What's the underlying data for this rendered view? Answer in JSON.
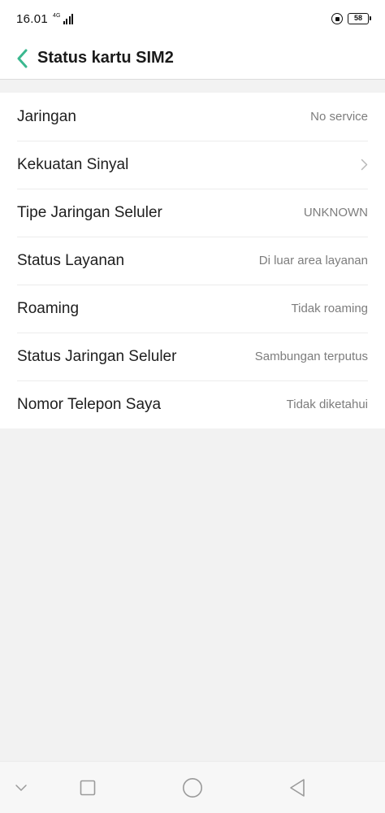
{
  "status_bar": {
    "time": "16.01",
    "network_type": "4G",
    "battery_level": "58"
  },
  "header": {
    "title": "Status kartu SIM2"
  },
  "rows": [
    {
      "label": "Jaringan",
      "value": "No service"
    },
    {
      "label": "Kekuatan Sinyal",
      "value": ""
    },
    {
      "label": "Tipe Jaringan Seluler",
      "value": "UNKNOWN"
    },
    {
      "label": "Status Layanan",
      "value": "Di luar area layanan"
    },
    {
      "label": "Roaming",
      "value": "Tidak roaming"
    },
    {
      "label": "Status Jaringan Seluler",
      "value": "Sambungan terputus"
    },
    {
      "label": "Nomor Telepon Saya",
      "value": "Tidak diketahui"
    }
  ],
  "colors": {
    "accent": "#3bb88f",
    "background": "#f2f2f2",
    "value_text": "#7d7d7d"
  },
  "icons": {
    "back": "chevron-left-icon",
    "row_disclosure": "chevron-right-icon",
    "nav_down": "chevron-down-icon",
    "nav_recents": "square-icon",
    "nav_home": "circle-icon",
    "nav_back": "triangle-back-icon"
  }
}
